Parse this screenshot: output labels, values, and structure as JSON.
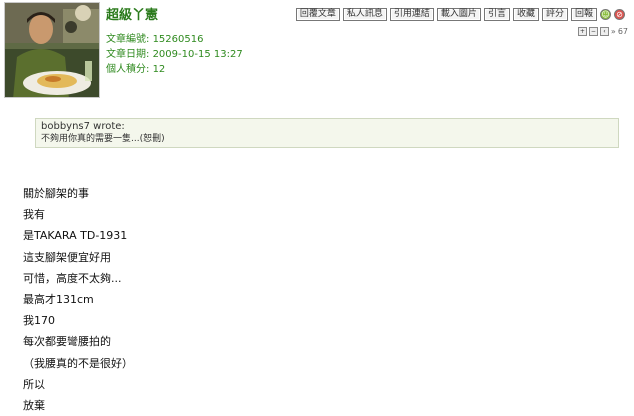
{
  "author": {
    "name": "超級丫憲"
  },
  "meta": {
    "article_id_label": "文章編號:",
    "article_id_value": "15260516",
    "date_label": "文章日期:",
    "date_value": "2009-10-15 13:27",
    "score_label": "個人積分:",
    "score_value": "12"
  },
  "toolbar": {
    "buttons": [
      "回覆文章",
      "私人訊息",
      "引用連結",
      "載入圖片",
      "引言",
      "收藏",
      "評分",
      "回報"
    ],
    "icons": [
      "smile-icon",
      "ban-icon"
    ]
  },
  "post_nav": {
    "count": "67"
  },
  "quote": {
    "who": "bobbyns7 wrote:",
    "text": "不夠用你真的需要一隻...(恕刪)"
  },
  "body": {
    "lines": [
      "關於腳架的事",
      "我有",
      "是TAKARA TD-1931",
      "這支腳架便宜好用",
      "可惜，高度不太夠...",
      "最高才131cm",
      "我170",
      "每次都要彎腰拍的",
      "（我腰真的不是很好）",
      "所以",
      "放棄"
    ]
  }
}
